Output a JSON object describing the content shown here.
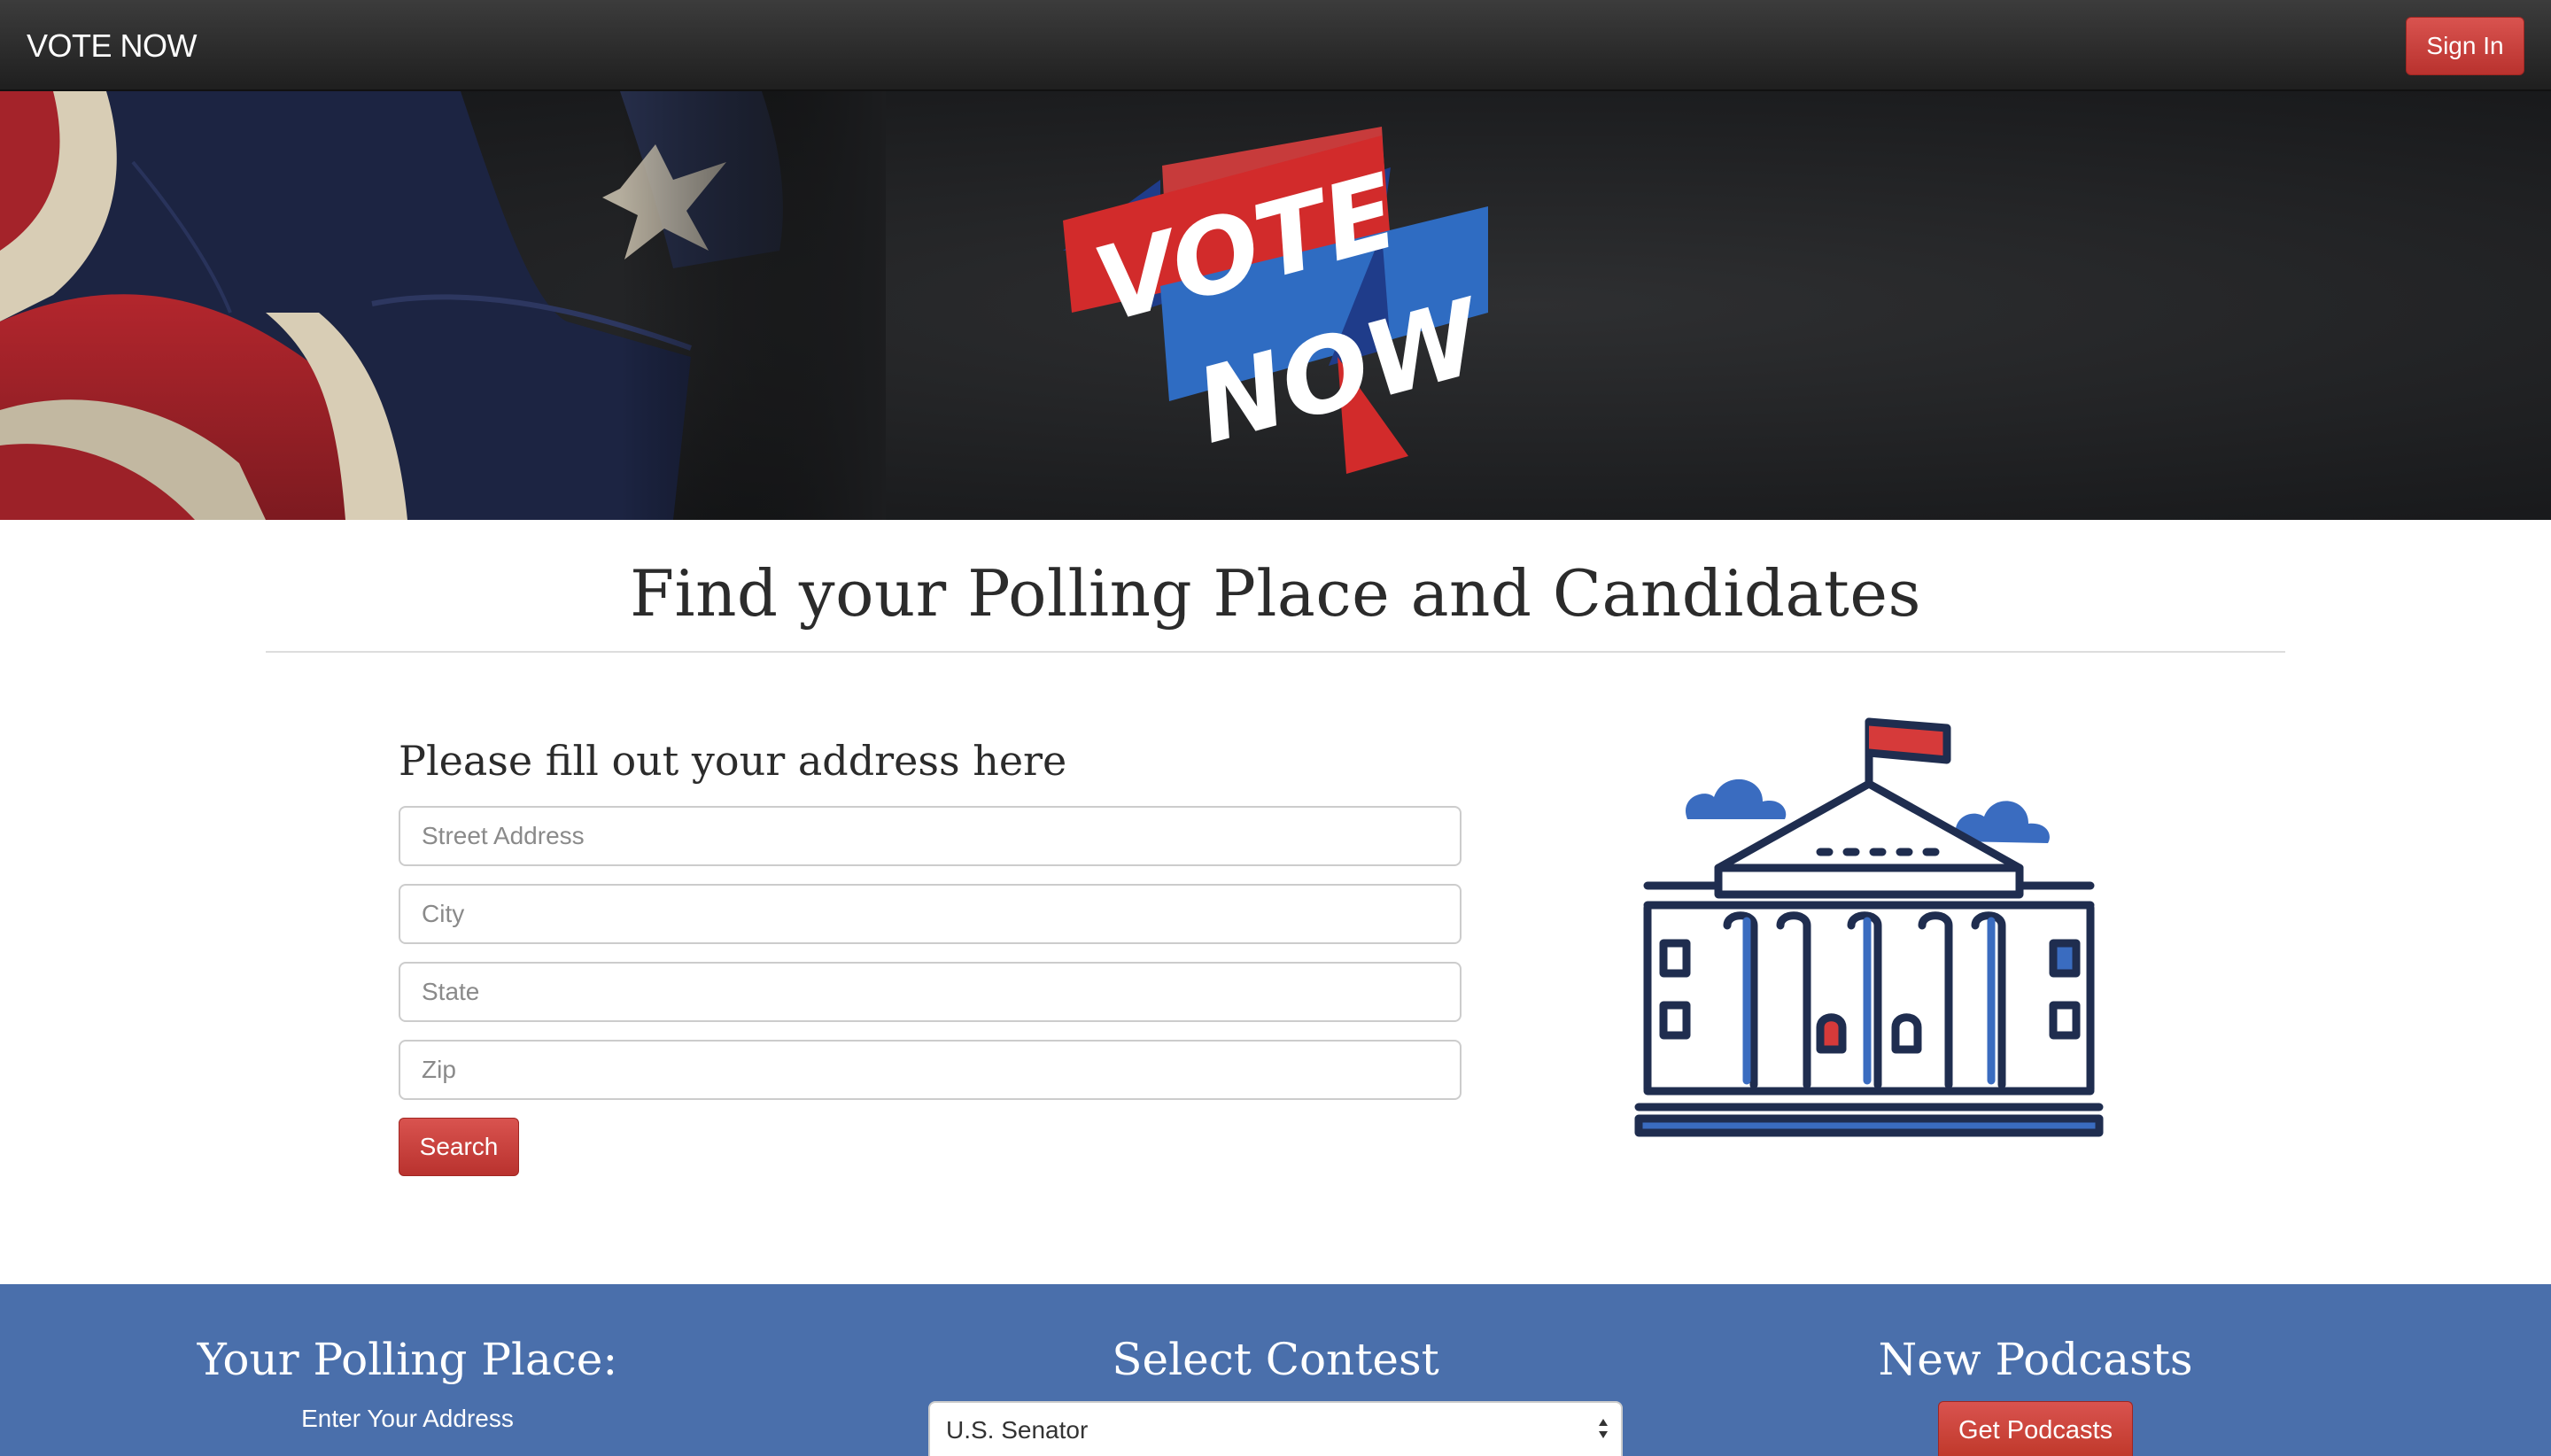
{
  "navbar": {
    "brand": "VOTE NOW",
    "signin_label": "Sign In"
  },
  "hero": {
    "logo_line1": "VOTE",
    "logo_line2": "NOW"
  },
  "main": {
    "title": "Find your Polling Place and Candidates",
    "form_title": "Please fill out your address here",
    "fields": [
      {
        "placeholder": "Street Address",
        "value": ""
      },
      {
        "placeholder": "City",
        "value": ""
      },
      {
        "placeholder": "State",
        "value": ""
      },
      {
        "placeholder": "Zip",
        "value": ""
      }
    ],
    "search_label": "Search"
  },
  "band": {
    "polling_title": "Your Polling Place:",
    "polling_sub": "Enter Your Address",
    "contest_title": "Select Contest",
    "contest_selected": "U.S. Senator",
    "podcasts_title": "New Podcasts",
    "podcasts_button": "Get Podcasts"
  },
  "colors": {
    "accent_red": "#c9302c",
    "band_blue": "#4a6fab",
    "navy": "#1f2d4f",
    "logo_blue": "#2f6cc2"
  }
}
